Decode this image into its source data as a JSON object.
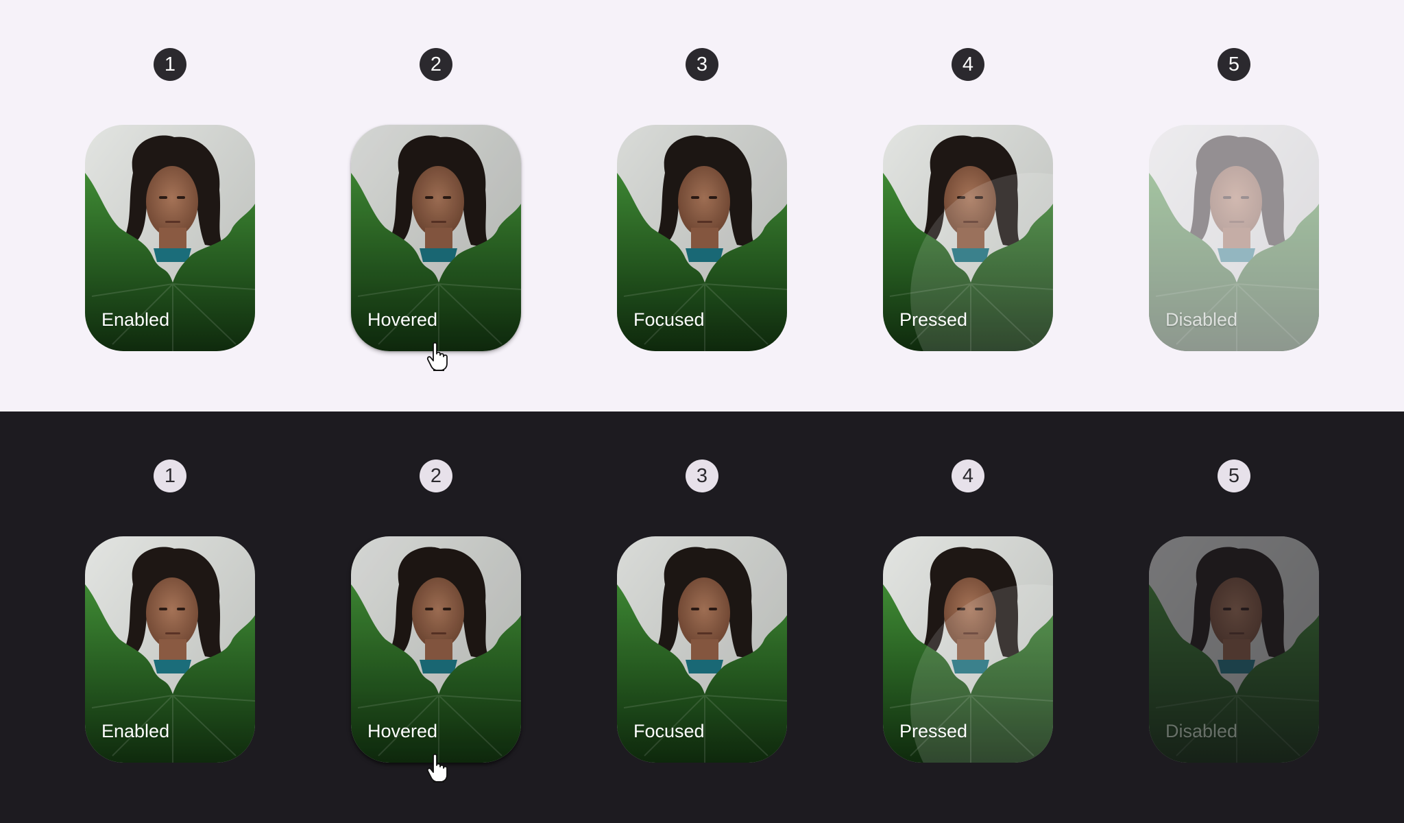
{
  "light_panel": {
    "items": [
      {
        "number": "1",
        "label": "Enabled"
      },
      {
        "number": "2",
        "label": "Hovered"
      },
      {
        "number": "3",
        "label": "Focused"
      },
      {
        "number": "4",
        "label": "Pressed"
      },
      {
        "number": "5",
        "label": "Disabled"
      }
    ]
  },
  "dark_panel": {
    "items": [
      {
        "number": "1",
        "label": "Enabled"
      },
      {
        "number": "2",
        "label": "Hovered"
      },
      {
        "number": "3",
        "label": "Focused"
      },
      {
        "number": "4",
        "label": "Pressed"
      },
      {
        "number": "5",
        "label": "Disabled"
      }
    ]
  },
  "colors": {
    "light_background": "#f6f2f9",
    "dark_background": "#1d1b20",
    "leaf_green": "#2f6b2a",
    "wall_gray": "#cfd2cf"
  },
  "icons": {
    "cursor": "hand-pointer-icon"
  }
}
